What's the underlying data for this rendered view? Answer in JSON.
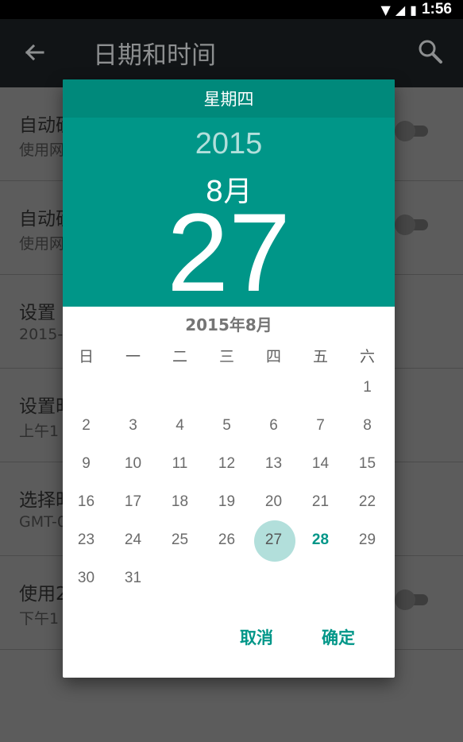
{
  "status_bar": {
    "time": "1:56"
  },
  "app_bar": {
    "title": "日期和时间"
  },
  "settings_rows": [
    {
      "title": "自动确",
      "subtitle": "使用网",
      "has_toggle": true
    },
    {
      "title": "自动确",
      "subtitle": "使用网",
      "has_toggle": true
    },
    {
      "title": "设置",
      "subtitle": "2015-",
      "has_toggle": false
    },
    {
      "title": "设置时",
      "subtitle": "上午1",
      "has_toggle": false
    },
    {
      "title": "选择时",
      "subtitle": "GMT-0",
      "has_toggle": false
    },
    {
      "title": "使用2",
      "subtitle": "下午1",
      "has_toggle": true
    }
  ],
  "dialog": {
    "weekday": "星期四",
    "year": "2015",
    "month": "8月",
    "day": "27",
    "calendar_title": "2015年8月",
    "weekdays": [
      "日",
      "一",
      "二",
      "三",
      "四",
      "五",
      "六"
    ],
    "first_weekday_index": 6,
    "days_in_month": 31,
    "selected_day": 27,
    "today": 28,
    "cancel_label": "取消",
    "ok_label": "确定"
  },
  "colors": {
    "accent": "#009688",
    "accent_dark": "#00897b",
    "selected_circle": "#b2dfdb",
    "app_bar": "#111416"
  }
}
